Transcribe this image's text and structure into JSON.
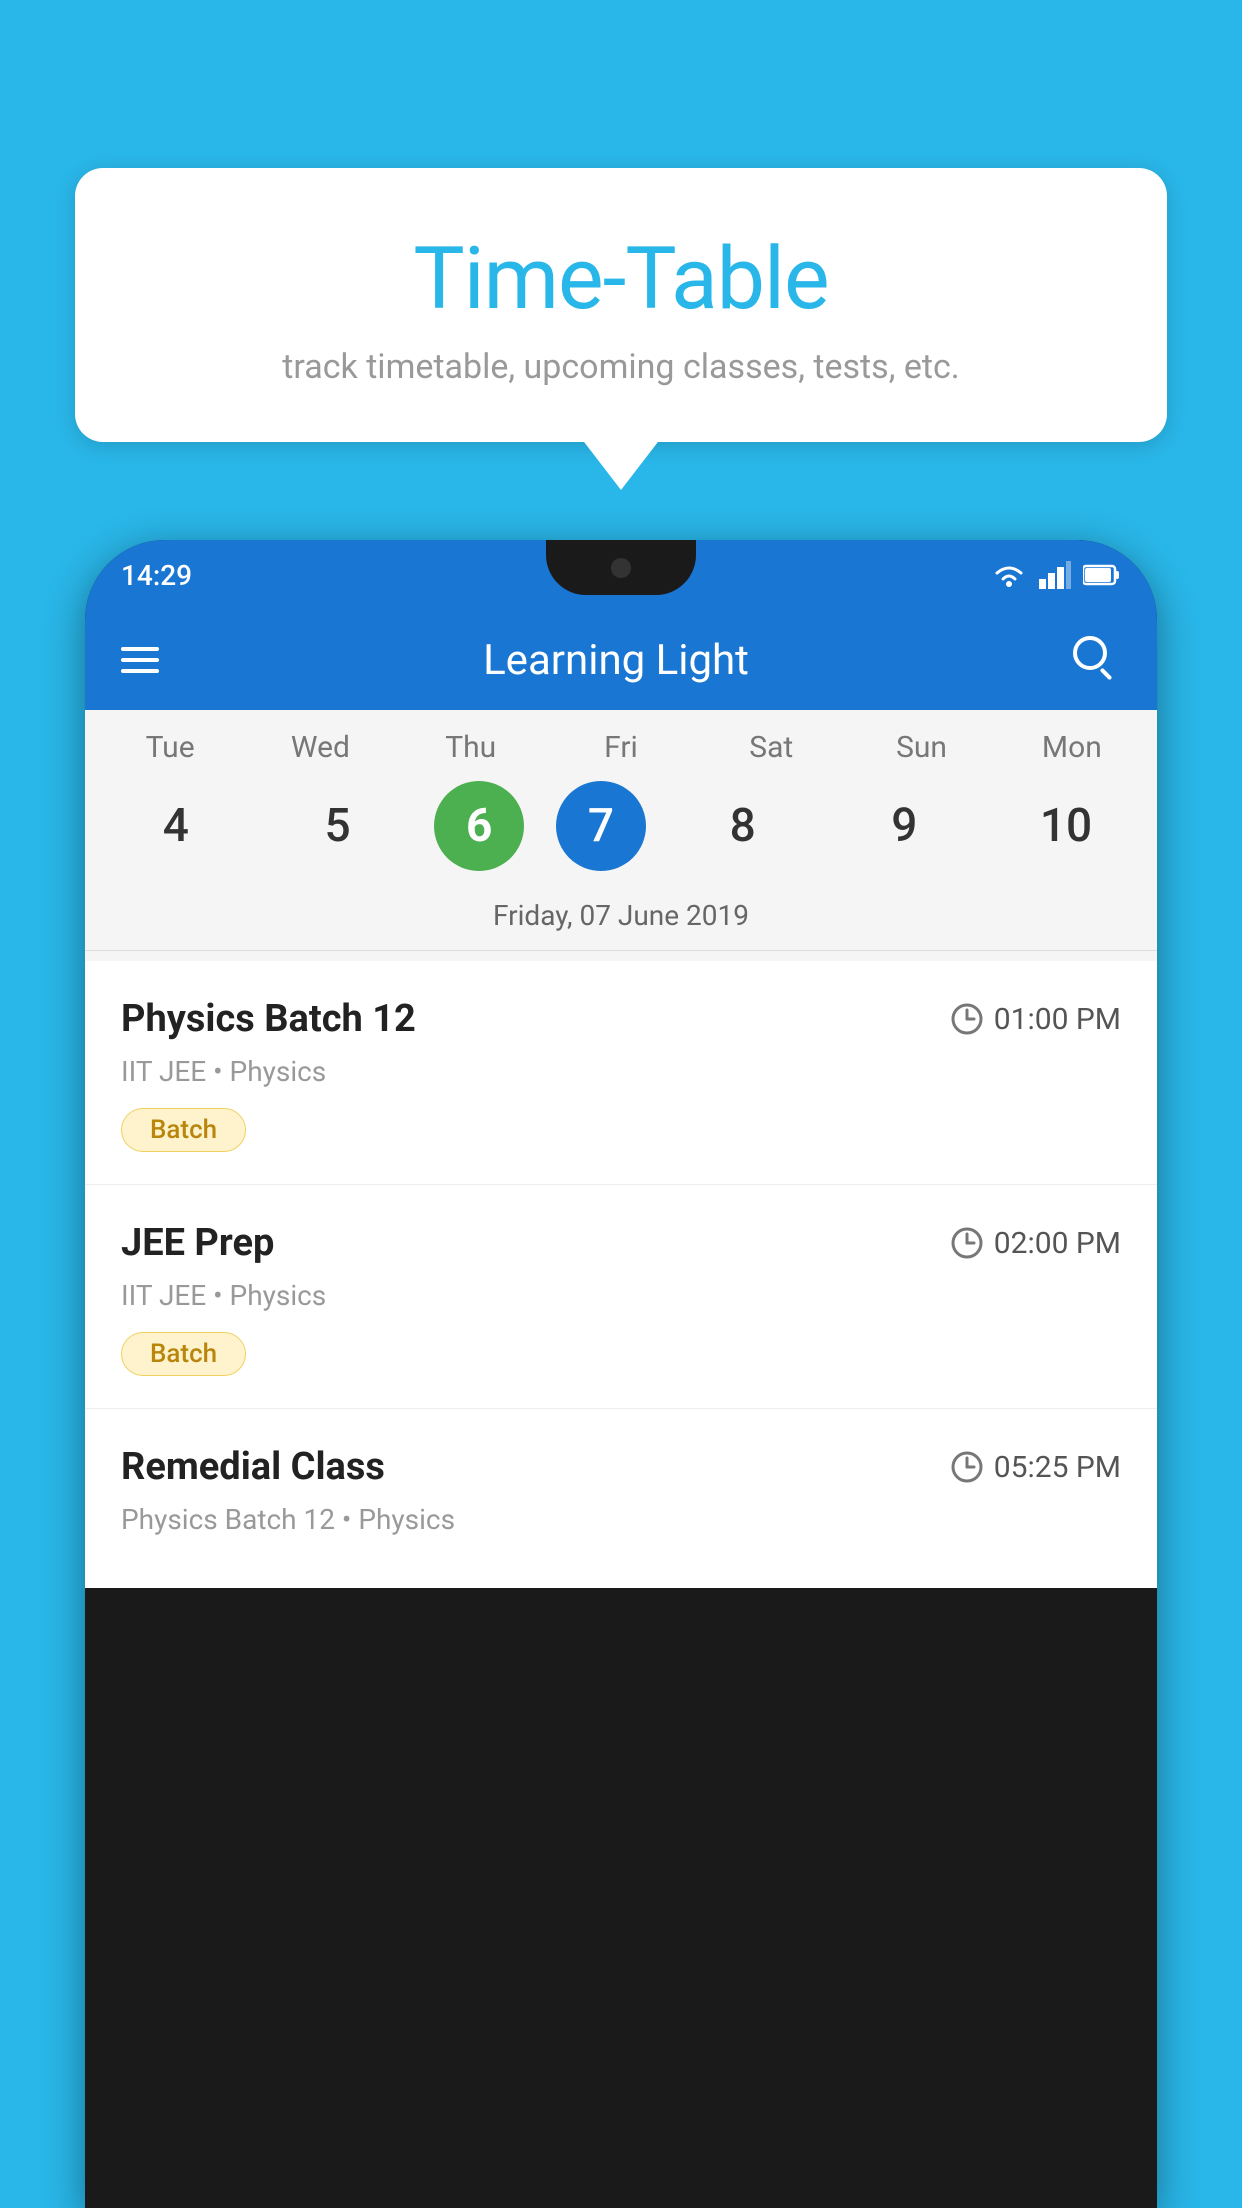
{
  "background_color": "#29B6E8",
  "speech_bubble": {
    "title": "Time-Table",
    "subtitle": "track timetable, upcoming classes, tests, etc."
  },
  "phone": {
    "status_bar": {
      "time": "14:29",
      "icons": [
        "wifi",
        "signal",
        "battery"
      ]
    },
    "app_bar": {
      "title": "Learning Light"
    },
    "calendar": {
      "days": [
        "Tue",
        "Wed",
        "Thu",
        "Fri",
        "Sat",
        "Sun",
        "Mon"
      ],
      "dates": [
        {
          "num": "4",
          "state": "normal"
        },
        {
          "num": "5",
          "state": "normal"
        },
        {
          "num": "6",
          "state": "today"
        },
        {
          "num": "7",
          "state": "selected"
        },
        {
          "num": "8",
          "state": "normal"
        },
        {
          "num": "9",
          "state": "normal"
        },
        {
          "num": "10",
          "state": "normal"
        }
      ],
      "selected_label": "Friday, 07 June 2019"
    },
    "schedule": [
      {
        "class_name": "Physics Batch 12",
        "time": "01:00 PM",
        "meta": "IIT JEE • Physics",
        "badge": "Batch"
      },
      {
        "class_name": "JEE Prep",
        "time": "02:00 PM",
        "meta": "IIT JEE • Physics",
        "badge": "Batch"
      },
      {
        "class_name": "Remedial Class",
        "time": "05:25 PM",
        "meta": "Physics Batch 12 • Physics",
        "badge": null
      }
    ]
  }
}
